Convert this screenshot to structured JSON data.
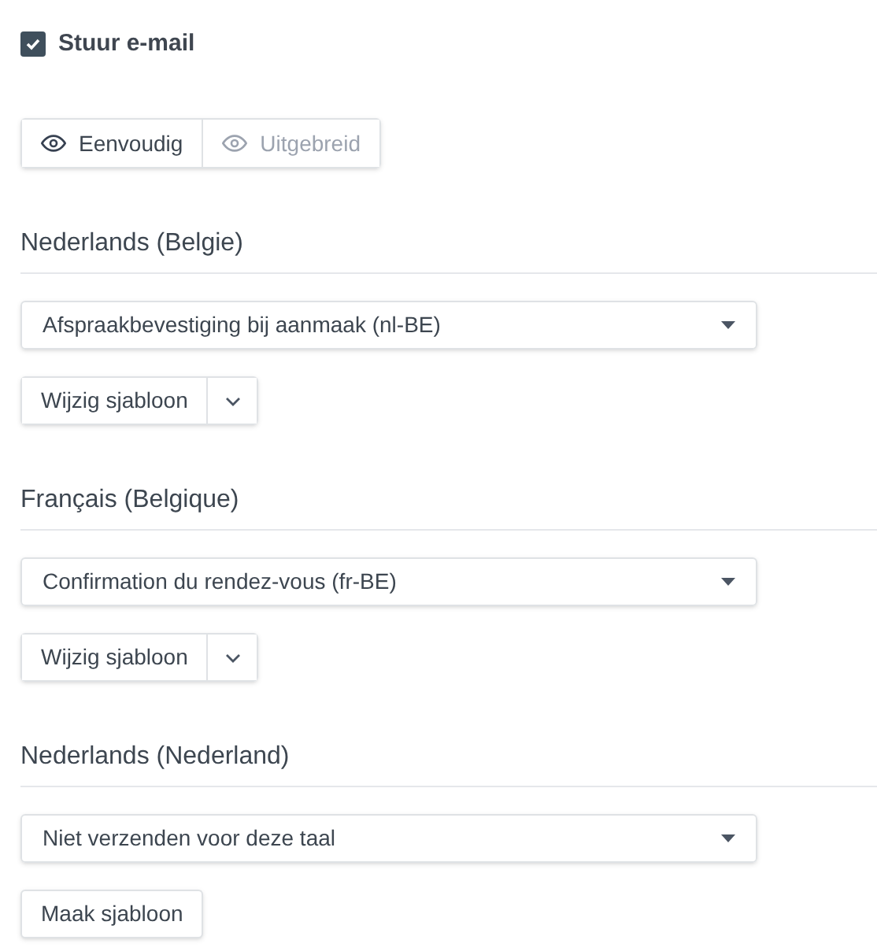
{
  "send_email": {
    "label": "Stuur e-mail",
    "checked": true
  },
  "view_modes": [
    {
      "label": "Eenvoudig",
      "selected": true
    },
    {
      "label": "Uitgebreid",
      "selected": false
    }
  ],
  "languages": [
    {
      "heading": "Nederlands (Belgie)",
      "template": "Afspraakbevestiging bij aanmaak (nl-BE)",
      "action": {
        "kind": "split",
        "label": "Wijzig sjabloon"
      }
    },
    {
      "heading": "Français (Belgique)",
      "template": "Confirmation du rendez-vous (fr-BE)",
      "action": {
        "kind": "split",
        "label": "Wijzig sjabloon"
      }
    },
    {
      "heading": "Nederlands (Nederland)",
      "template": "Niet verzenden voor deze taal",
      "action": {
        "kind": "plain",
        "label": "Maak sjabloon"
      }
    }
  ]
}
